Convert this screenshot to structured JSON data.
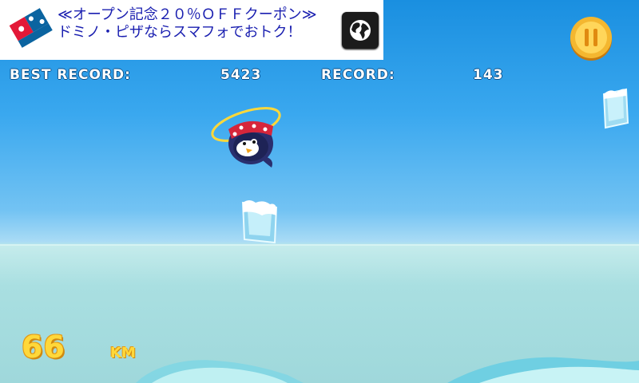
{
  "ad": {
    "logo_icon": "dominos-pizza-logo",
    "text": "≪オープン記念２０％ＯＦＦクーポン≫ドミノ・ピザならスマフォでおトク！",
    "globe_icon": "globe-icon"
  },
  "hud": {
    "best_record_label": "BEST RECORD:",
    "best_record_value": "5423",
    "record_label": "RECORD:",
    "record_value": "143",
    "distance_value": "66",
    "distance_unit": "KM"
  },
  "controls": {
    "pause_icon": "pause-icon"
  },
  "colors": {
    "sky_top": "#1a8fe0",
    "sea": "#a9dfe1",
    "hud_text": "#ffffff",
    "distance_text": "#ffd83a",
    "ad_text": "#1a1fb0"
  }
}
